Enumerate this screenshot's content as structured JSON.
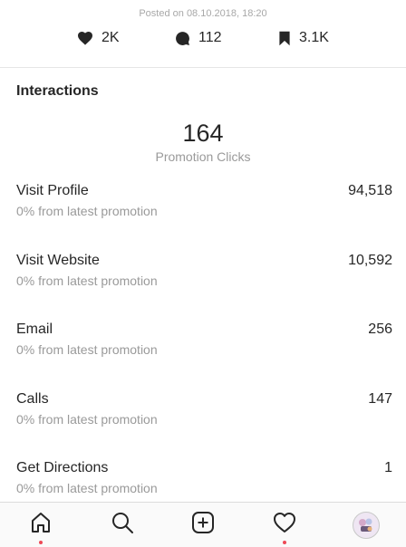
{
  "post": {
    "posted_on": "Posted on 08.10.2018, 18:20",
    "likes": "2K",
    "comments": "112",
    "saves": "3.1K"
  },
  "interactions": {
    "title": "Interactions",
    "promotion_clicks": "164",
    "promotion_clicks_label": "Promotion Clicks",
    "rows": [
      {
        "label": "Visit Profile",
        "value": "94,518",
        "sub": "0% from latest promotion"
      },
      {
        "label": "Visit Website",
        "value": "10,592",
        "sub": "0% from latest promotion"
      },
      {
        "label": "Email",
        "value": "256",
        "sub": "0% from latest promotion"
      },
      {
        "label": "Calls",
        "value": "147",
        "sub": "0% from latest promotion"
      },
      {
        "label": "Get Directions",
        "value": "1",
        "sub": "0% from latest promotion"
      }
    ]
  },
  "tabbar": {
    "icons": [
      "home-icon",
      "search-icon",
      "add-post-icon",
      "activity-heart-icon",
      "profile-avatar"
    ],
    "notification_dot_color": "#ed4956"
  }
}
